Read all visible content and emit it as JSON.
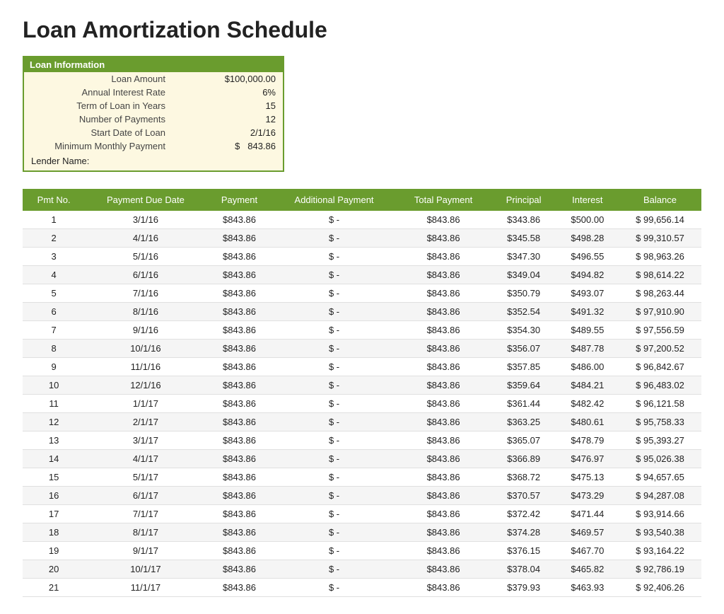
{
  "title": "Loan Amortization Schedule",
  "loanInfo": {
    "header": "Loan Information",
    "fields": [
      {
        "label": "Loan Amount",
        "value": "$100,000.00"
      },
      {
        "label": "Annual Interest Rate",
        "value": "6%"
      },
      {
        "label": "Term of Loan in Years",
        "value": "15"
      },
      {
        "label": "Number of Payments",
        "value": "12"
      },
      {
        "label": "Start Date of Loan",
        "value": "2/1/16"
      },
      {
        "label": "Minimum Monthly Payment",
        "value": "$   843.86"
      }
    ],
    "lenderLabel": "Lender Name:"
  },
  "table": {
    "headers": [
      "Pmt No.",
      "Payment Due Date",
      "Payment",
      "Additional Payment",
      "Total Payment",
      "Principal",
      "Interest",
      "Balance"
    ],
    "rows": [
      [
        1,
        "3/1/16",
        "$843.86",
        "$ -",
        "$843.86",
        "$343.86",
        "$500.00",
        "$ 99,656.14"
      ],
      [
        2,
        "4/1/16",
        "$843.86",
        "$ -",
        "$843.86",
        "$345.58",
        "$498.28",
        "$ 99,310.57"
      ],
      [
        3,
        "5/1/16",
        "$843.86",
        "$ -",
        "$843.86",
        "$347.30",
        "$496.55",
        "$ 98,963.26"
      ],
      [
        4,
        "6/1/16",
        "$843.86",
        "$ -",
        "$843.86",
        "$349.04",
        "$494.82",
        "$ 98,614.22"
      ],
      [
        5,
        "7/1/16",
        "$843.86",
        "$ -",
        "$843.86",
        "$350.79",
        "$493.07",
        "$ 98,263.44"
      ],
      [
        6,
        "8/1/16",
        "$843.86",
        "$ -",
        "$843.86",
        "$352.54",
        "$491.32",
        "$ 97,910.90"
      ],
      [
        7,
        "9/1/16",
        "$843.86",
        "$ -",
        "$843.86",
        "$354.30",
        "$489.55",
        "$ 97,556.59"
      ],
      [
        8,
        "10/1/16",
        "$843.86",
        "$ -",
        "$843.86",
        "$356.07",
        "$487.78",
        "$ 97,200.52"
      ],
      [
        9,
        "11/1/16",
        "$843.86",
        "$ -",
        "$843.86",
        "$357.85",
        "$486.00",
        "$ 96,842.67"
      ],
      [
        10,
        "12/1/16",
        "$843.86",
        "$ -",
        "$843.86",
        "$359.64",
        "$484.21",
        "$ 96,483.02"
      ],
      [
        11,
        "1/1/17",
        "$843.86",
        "$ -",
        "$843.86",
        "$361.44",
        "$482.42",
        "$ 96,121.58"
      ],
      [
        12,
        "2/1/17",
        "$843.86",
        "$ -",
        "$843.86",
        "$363.25",
        "$480.61",
        "$ 95,758.33"
      ],
      [
        13,
        "3/1/17",
        "$843.86",
        "$ -",
        "$843.86",
        "$365.07",
        "$478.79",
        "$ 95,393.27"
      ],
      [
        14,
        "4/1/17",
        "$843.86",
        "$ -",
        "$843.86",
        "$366.89",
        "$476.97",
        "$ 95,026.38"
      ],
      [
        15,
        "5/1/17",
        "$843.86",
        "$ -",
        "$843.86",
        "$368.72",
        "$475.13",
        "$ 94,657.65"
      ],
      [
        16,
        "6/1/17",
        "$843.86",
        "$ -",
        "$843.86",
        "$370.57",
        "$473.29",
        "$ 94,287.08"
      ],
      [
        17,
        "7/1/17",
        "$843.86",
        "$ -",
        "$843.86",
        "$372.42",
        "$471.44",
        "$ 93,914.66"
      ],
      [
        18,
        "8/1/17",
        "$843.86",
        "$ -",
        "$843.86",
        "$374.28",
        "$469.57",
        "$ 93,540.38"
      ],
      [
        19,
        "9/1/17",
        "$843.86",
        "$ -",
        "$843.86",
        "$376.15",
        "$467.70",
        "$ 93,164.22"
      ],
      [
        20,
        "10/1/17",
        "$843.86",
        "$ -",
        "$843.86",
        "$378.04",
        "$465.82",
        "$ 92,786.19"
      ],
      [
        21,
        "11/1/17",
        "$843.86",
        "$ -",
        "$843.86",
        "$379.93",
        "$463.93",
        "$ 92,406.26"
      ]
    ]
  }
}
